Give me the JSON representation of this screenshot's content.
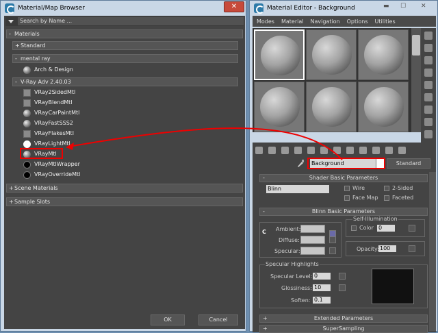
{
  "browser": {
    "title": "Material/Map Browser",
    "close": "✕",
    "search_placeholder": "Search by Name ...",
    "groups": [
      {
        "sign": "-",
        "label": "Materials"
      },
      {
        "sign": "+",
        "label": "Standard"
      },
      {
        "sign": "-",
        "label": "mental ray"
      },
      {
        "sign": "-",
        "label": "V-Ray Adv 2.40.03"
      },
      {
        "sign": "+",
        "label": "Scene Materials"
      },
      {
        "sign": "+",
        "label": "Sample Slots"
      }
    ],
    "mentalray_items": [
      "Arch & Design"
    ],
    "vray_items": [
      "VRay2SidedMtl",
      "VRayBlendMtl",
      "VRayCarPaintMtl",
      "VRayFastSSS2",
      "VRayFlakesMtl",
      "VRayLightMtl",
      "VRayMtl",
      "VRayMtlWrapper",
      "VRayOverrideMtl"
    ],
    "ok": "OK",
    "cancel": "Cancel"
  },
  "editor": {
    "title": "Material Editor - Background",
    "menu": [
      "Modes",
      "Material",
      "Navigation",
      "Options",
      "Utilities"
    ],
    "name_value": "Background",
    "type_button": "Standard",
    "shader_basic": {
      "header": "Shader Basic Parameters",
      "shader": "Blinn",
      "wire": "Wire",
      "two_sided": "2-Sided",
      "face_map": "Face Map",
      "faceted": "Faceted"
    },
    "blinn_basic": {
      "header": "Blinn Basic Parameters",
      "self_illum": "Self-Illumination",
      "color": "Color",
      "color_val": "0",
      "ambient": "Ambient:",
      "diffuse": "Diffuse:",
      "specular": "Specular:",
      "opacity": "Opacity:",
      "opacity_val": "100",
      "lock": "C"
    },
    "specular_highlights": {
      "header": "Specular Highlights",
      "level_label": "Specular Level:",
      "level": "0",
      "gloss_label": "Glossiness:",
      "gloss": "10",
      "soften_label": "Soften:",
      "soften": "0.1"
    },
    "extended": "Extended Parameters",
    "supersampling": "SuperSampling",
    "plus": "+",
    "minus": "-"
  }
}
